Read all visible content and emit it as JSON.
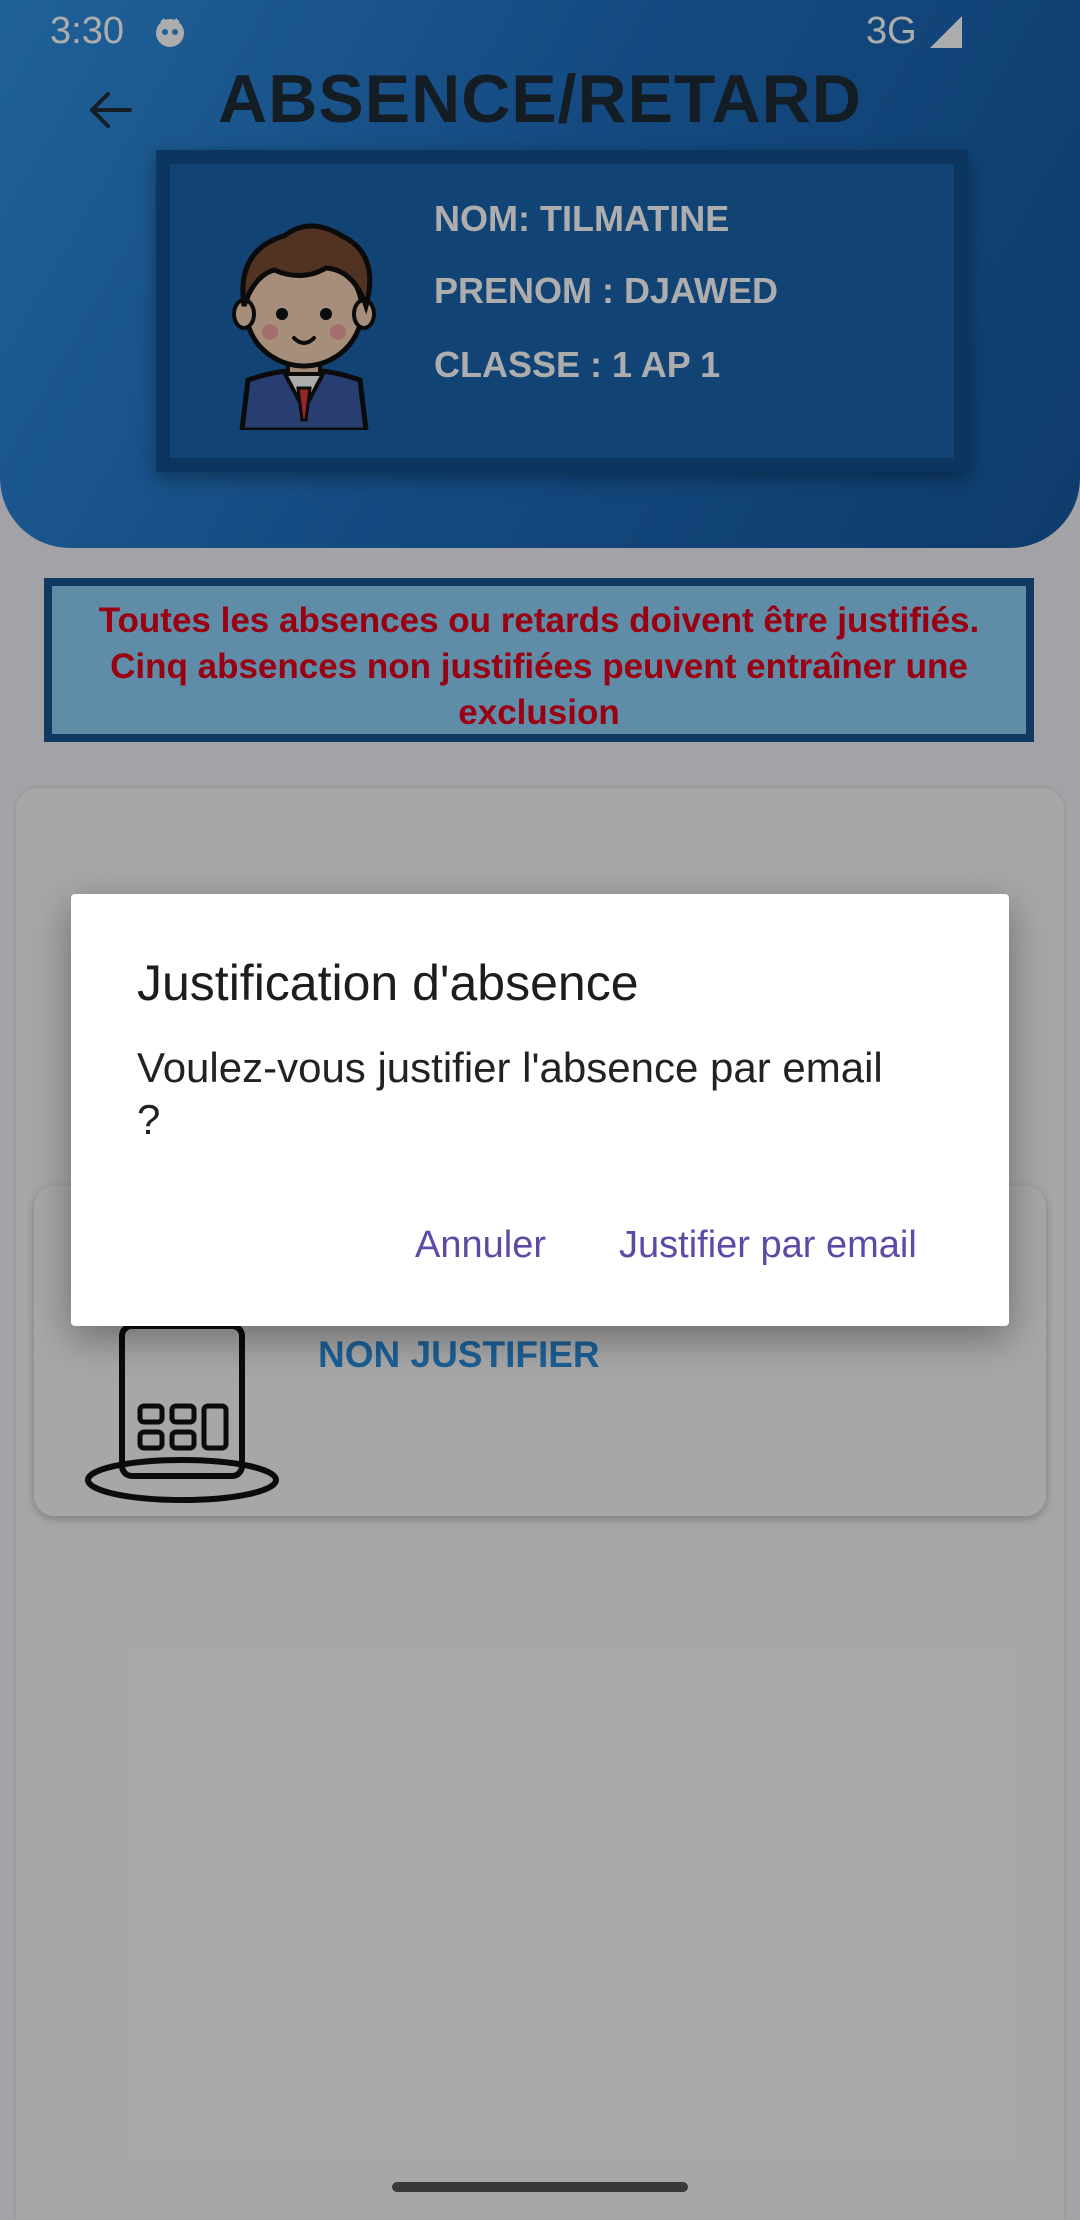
{
  "status_bar": {
    "time": "3:30",
    "network": "3G"
  },
  "header": {
    "title": "ABSENCE/RETARD"
  },
  "student": {
    "nom": "NOM: TILMATINE",
    "prenom": "PRENOM : DJAWED",
    "classe": "CLASSE : 1 AP 1"
  },
  "warning": {
    "line1": "Toutes les absences ou retards doivent être justifiés.",
    "line2": "Cinq absences non justifiées peuvent entraîner une",
    "line3": "exclusion",
    "text_color": "#e2001a"
  },
  "absence_card": {
    "status": "NON JUSTIFIER"
  },
  "dialog": {
    "title": "Justification d'absence",
    "message": "Voulez-vous justifier l'absence par email ?",
    "cancel_label": "Annuler",
    "confirm_label": "Justifier par email",
    "button_color": "#5e4aa6"
  },
  "colors": {
    "header_gradient_start": "#2f8fe0",
    "header_gradient_end": "#14589f",
    "warning_bg": "#8ccff7"
  }
}
